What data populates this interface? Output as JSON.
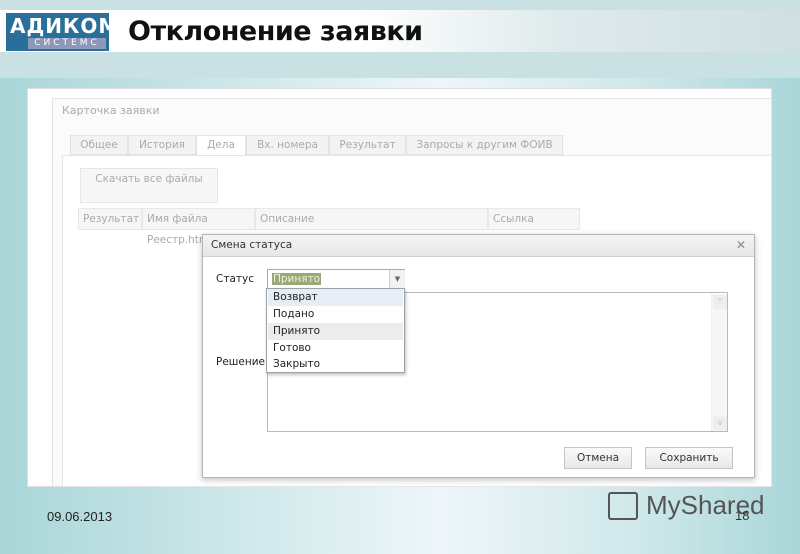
{
  "slide": {
    "logo_top": "АДИКОМ",
    "logo_bottom": "СИСТЕМС",
    "title": "Отклонение заявки",
    "date": "09.06.2013",
    "page_number": "18",
    "watermark": "MyShared"
  },
  "card": {
    "title": "Карточка заявки",
    "tabs": [
      {
        "label": "Общее"
      },
      {
        "label": "История"
      },
      {
        "label": "Дела",
        "active": true
      },
      {
        "label": "Вх. номера"
      },
      {
        "label": "Результат"
      },
      {
        "label": "Запросы к другим ФОИВ"
      }
    ],
    "download_button": "Скачать все файлы",
    "columns": [
      "Результат",
      "Имя файла",
      "Описание",
      "Ссылка"
    ],
    "rows": [
      {
        "file_name": "Реестр.htm"
      }
    ]
  },
  "dialog": {
    "title": "Смена статуса",
    "close_icon": "close-icon",
    "status_label": "Статус",
    "status_value": "Принято",
    "status_options": [
      "Возврат",
      "Подано",
      "Принято",
      "Готово",
      "Закрыто"
    ],
    "decision_label": "Решение",
    "decision_value": "",
    "cancel_label": "Отмена",
    "save_label": "Сохранить"
  }
}
